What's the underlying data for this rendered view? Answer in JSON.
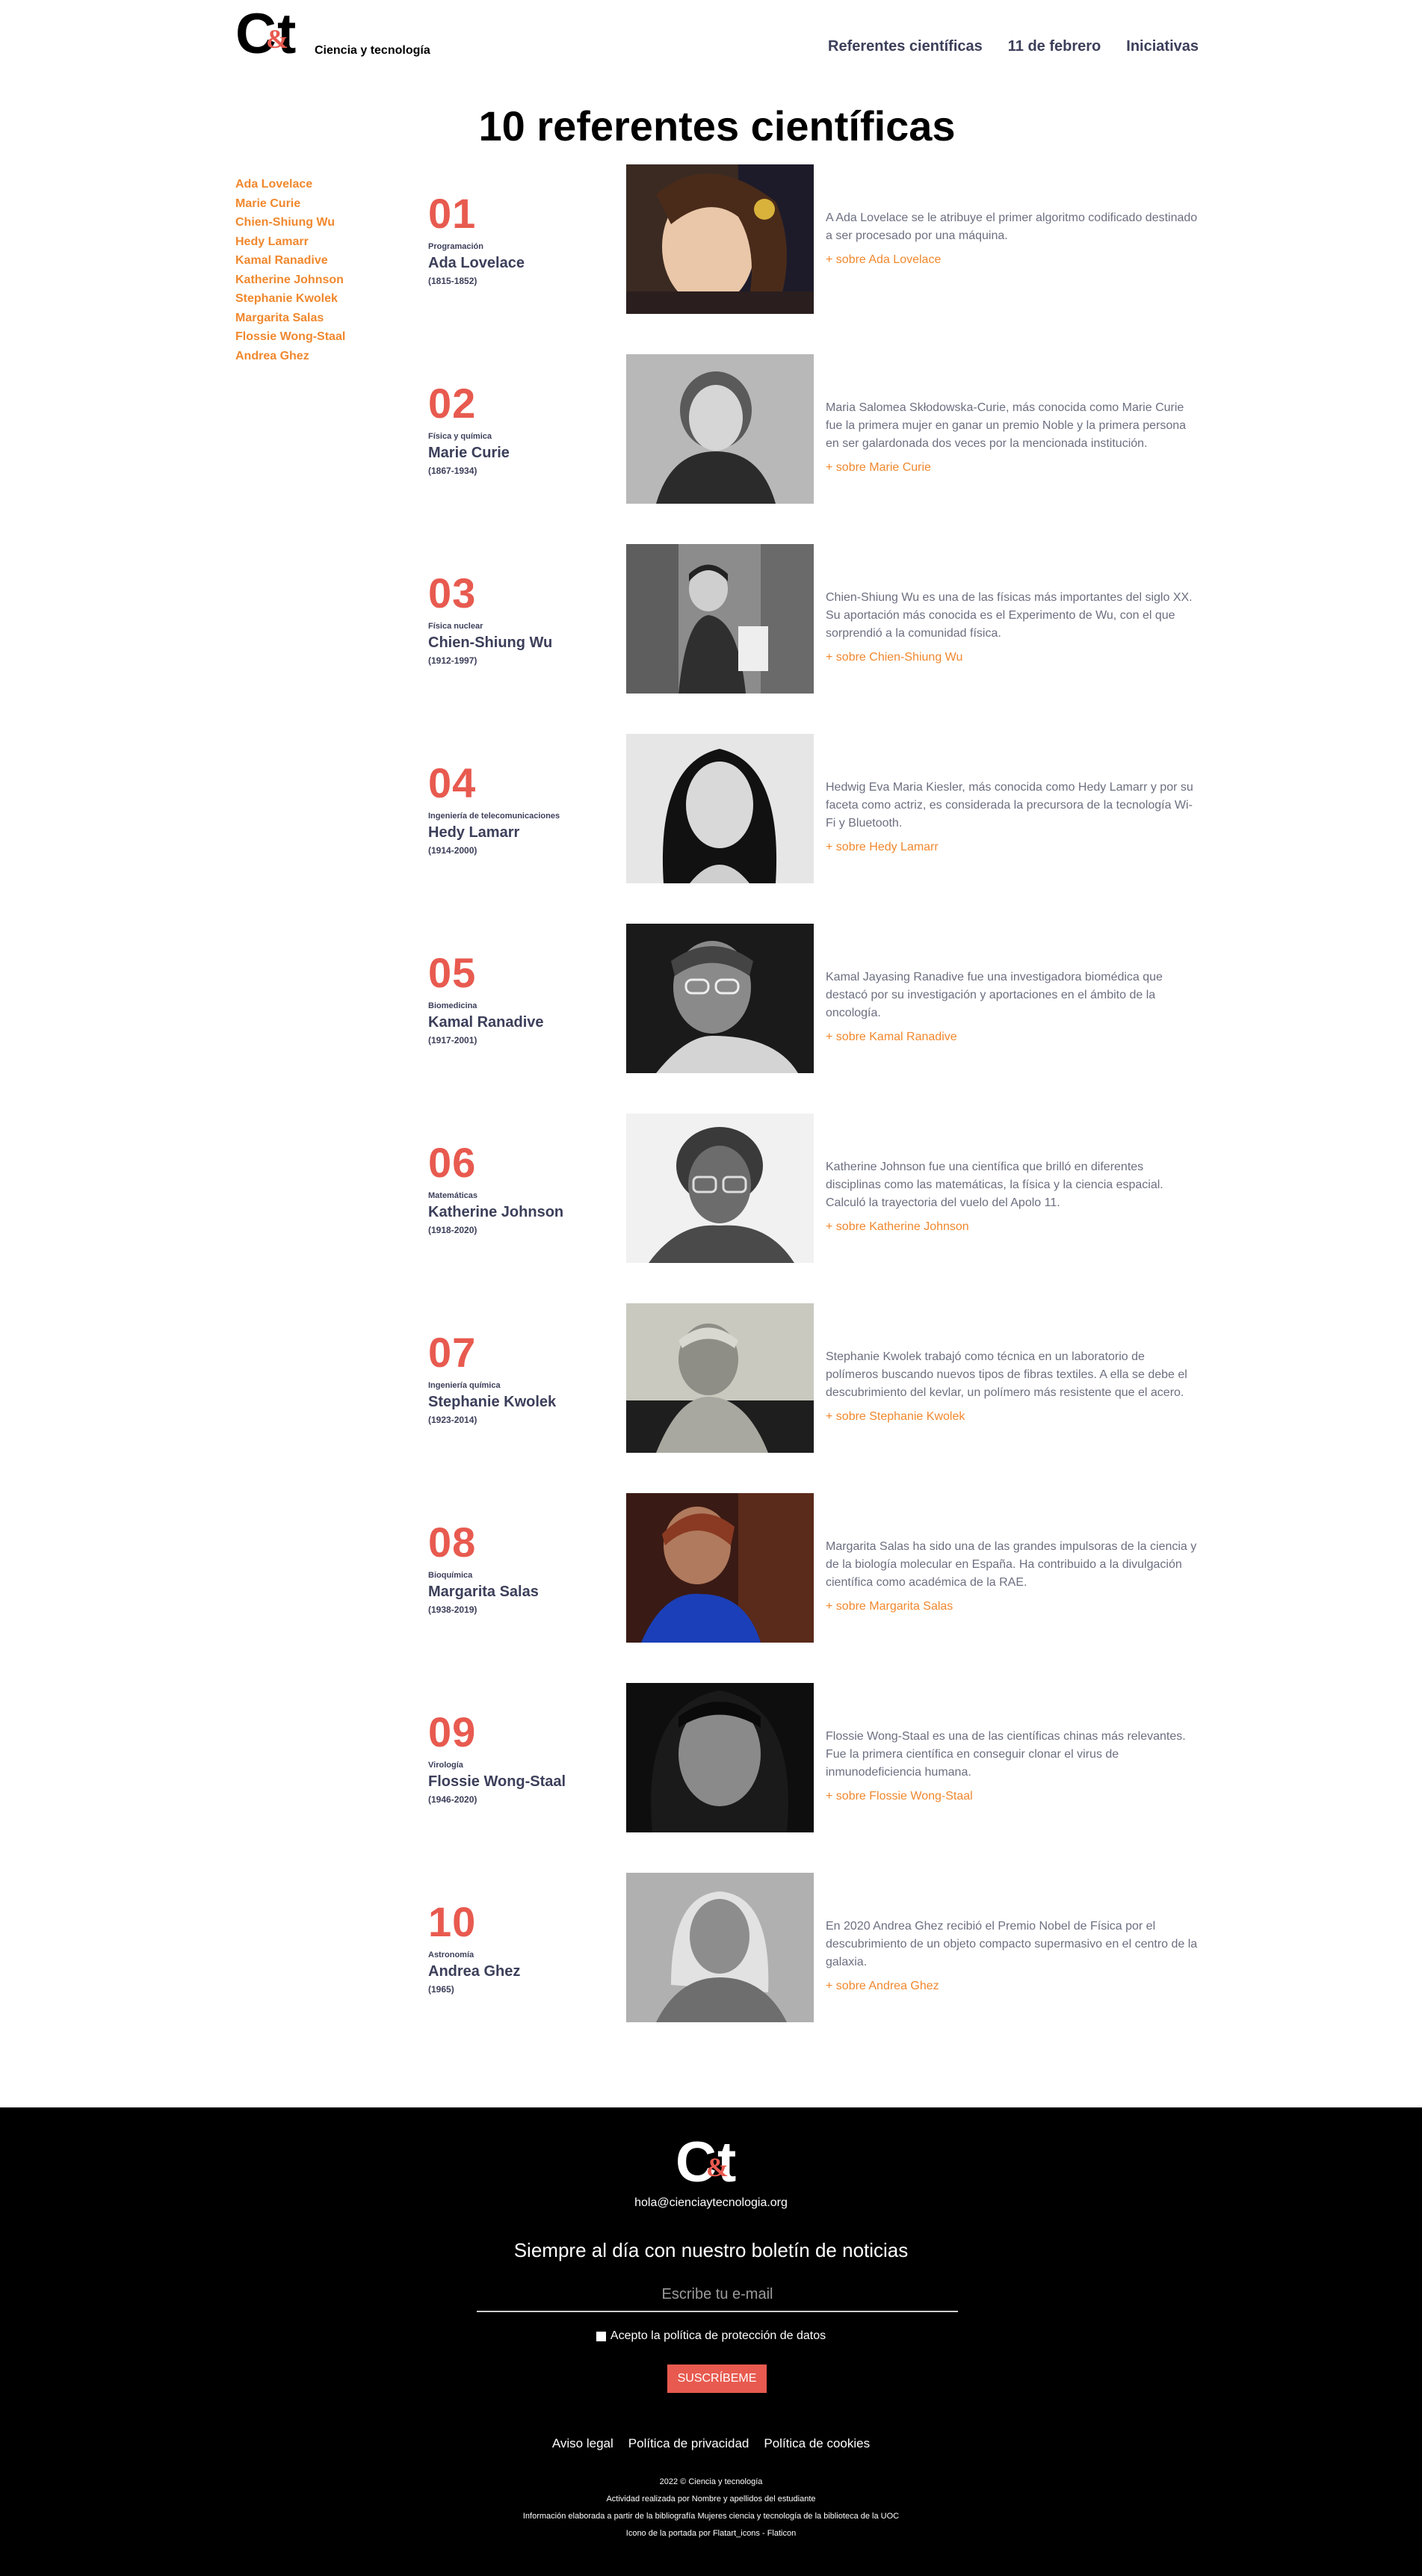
{
  "header": {
    "logo_text": "Ciencia y tecnología",
    "logo_mark": {
      "c": "C",
      "amp": "&",
      "t": "t"
    },
    "nav": [
      "Referentes científicas",
      "11 de febrero",
      "Iniciativas"
    ]
  },
  "page_title": "10 referentes científicas",
  "sidebar": {
    "items": [
      "Ada Lovelace",
      "Marie Curie",
      "Chien-Shiung Wu",
      "Hedy Lamarr",
      "Kamal Ranadive",
      "Katherine Johnson",
      "Stephanie Kwolek",
      "Margarita Salas",
      "Flossie Wong-Staal",
      "Andrea Ghez"
    ]
  },
  "entries": [
    {
      "num": "01",
      "field": "Programación",
      "name": "Ada Lovelace",
      "years": "(1815-1852)",
      "desc": "A Ada Lovelace se le atribuye el primer algoritmo codificado destinado a ser procesado por una máquina.",
      "more": "+ sobre Ada Lovelace"
    },
    {
      "num": "02",
      "field": "Física y química",
      "name": "Marie Curie",
      "years": "(1867-1934)",
      "desc": "Maria Salomea Skłodowska-Curie, más conocida como Marie Curie fue la primera mujer en ganar un premio Noble y la primera persona en ser galardonada dos veces por la mencionada institución.",
      "more": "+ sobre Marie Curie"
    },
    {
      "num": "03",
      "field": "Física nuclear",
      "name": "Chien-Shiung Wu",
      "years": "(1912-1997)",
      "desc": "Chien-Shiung Wu es una de las físicas más importantes del siglo XX. Su aportación más conocida es el Experimento de Wu, con el que sorprendió a la comunidad física.",
      "more": "+ sobre Chien-Shiung Wu"
    },
    {
      "num": "04",
      "field": "Ingeniería de telecomunicaciones",
      "name": "Hedy Lamarr",
      "years": "(1914-2000)",
      "desc": "Hedwig Eva Maria Kiesler, más conocida como Hedy Lamarr y por su faceta como actriz, es considerada la precursora de la tecnología Wi-Fi y Bluetooth.",
      "more": "+ sobre Hedy Lamarr"
    },
    {
      "num": "05",
      "field": "Biomedicina",
      "name": "Kamal Ranadive",
      "years": "(1917-2001)",
      "desc": "Kamal Jayasing Ranadive fue una investigadora biomédica que destacó por su investigación y aportaciones en el ámbito de la oncología.",
      "more": "+ sobre Kamal Ranadive"
    },
    {
      "num": "06",
      "field": "Matemáticas",
      "name": "Katherine Johnson",
      "years": "(1918-2020)",
      "desc": "Katherine Johnson fue una científica que brilló en diferentes disciplinas como las matemáticas, la física y la ciencia espacial. Calculó la trayectoria del vuelo del Apolo 11.",
      "more": "+ sobre Katherine Johnson"
    },
    {
      "num": "07",
      "field": "Ingeniería química",
      "name": "Stephanie Kwolek",
      "years": "(1923-2014)",
      "desc": "Stephanie Kwolek trabajó como técnica en un laboratorio de polímeros buscando nuevos tipos de fibras textiles. A ella se debe el descubrimiento del kevlar, un polímero más resistente que el acero.",
      "more": "+ sobre Stephanie Kwolek"
    },
    {
      "num": "08",
      "field": "Bioquímica",
      "name": "Margarita Salas",
      "years": "(1938-2019)",
      "desc": "Margarita Salas ha sido una de las grandes impulsoras de la ciencia y de la biología molecular en España. Ha contribuido a la divulgación científica como académica de la RAE.",
      "more": "+ sobre Margarita Salas"
    },
    {
      "num": "09",
      "field": "Virología",
      "name": "Flossie Wong-Staal",
      "years": "(1946-2020)",
      "desc": "Flossie Wong-Staal es una de las científicas chinas más relevantes. Fue la primera científica en conseguir clonar el virus de inmunodeficiencia humana.",
      "more": "+ sobre Flossie Wong-Staal"
    },
    {
      "num": "10",
      "field": "Astronomía",
      "name": "Andrea Ghez",
      "years": "(1965)",
      "desc": "En 2020 Andrea Ghez recibió el Premio Nobel de Física por el descubrimiento de un objeto compacto supermasivo en el centro de la galaxia.",
      "more": "+ sobre Andrea Ghez"
    }
  ],
  "footer": {
    "email": "hola@cienciaytecnologia.org",
    "newsletter_heading": "Siempre al día con nuestro boletín de noticias",
    "email_placeholder": "Escribe tu e-mail",
    "consent_label": "Acepto la política de protección de datos",
    "subscribe_label": "SUSCRÍBEME",
    "links": [
      "Aviso legal",
      "Política de privacidad",
      "Política de cookies"
    ],
    "credits": [
      "2022 © Ciencia y tecnología",
      "Actividad realizada por Nombre y apellidos del estudiante",
      "Información elaborada a partir de la bibliografía Mujeres ciencia y tecnología de la biblioteca de la UOC",
      "Icono de la portada por Flatart_icons - Flaticon"
    ]
  },
  "colors": {
    "accent_orange": "#f0882e",
    "accent_red": "#e85a4f",
    "text_dark": "#3c3f5a",
    "footer_bg": "#000000"
  }
}
